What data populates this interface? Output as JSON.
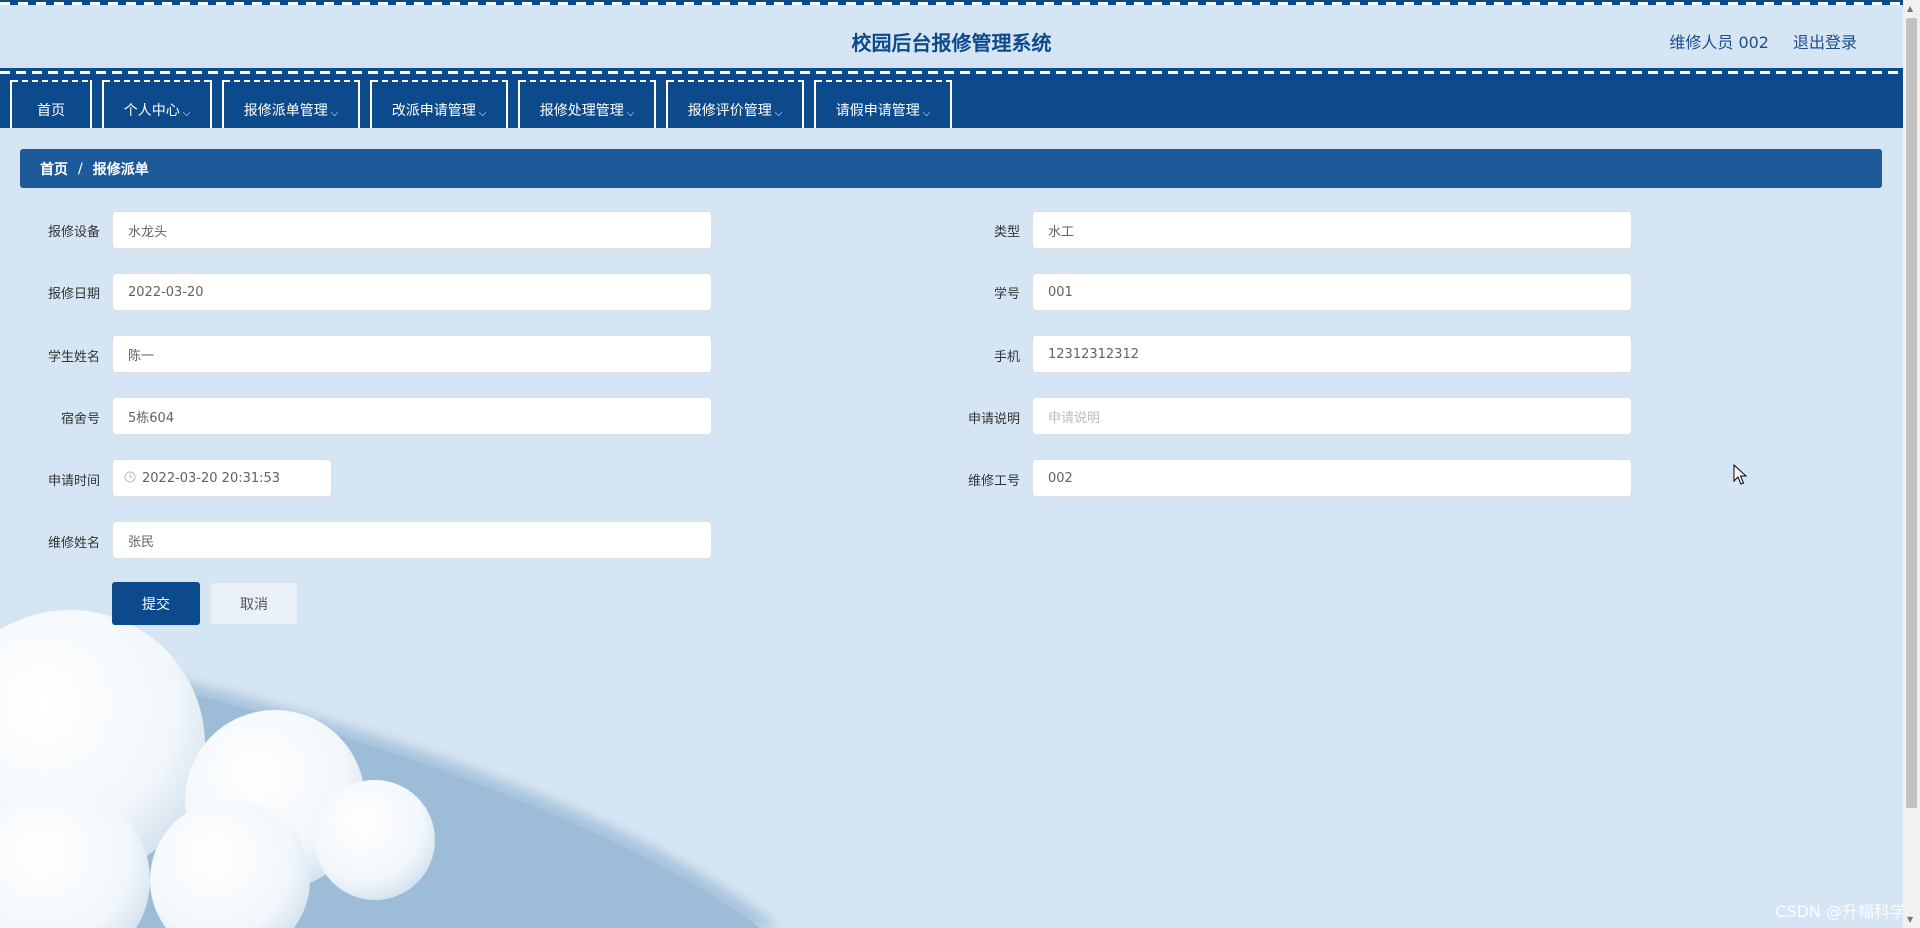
{
  "header": {
    "title": "校园后台报修管理系统",
    "user": "维修人员 002",
    "logout": "退出登录"
  },
  "nav": {
    "items": [
      {
        "label": "首页",
        "has_dropdown": false
      },
      {
        "label": "个人中心",
        "has_dropdown": true
      },
      {
        "label": "报修派单管理",
        "has_dropdown": true
      },
      {
        "label": "改派申请管理",
        "has_dropdown": true
      },
      {
        "label": "报修处理管理",
        "has_dropdown": true
      },
      {
        "label": "报修评价管理",
        "has_dropdown": true
      },
      {
        "label": "请假申请管理",
        "has_dropdown": true
      }
    ],
    "chevron": "⌵"
  },
  "breadcrumb": {
    "home": "首页",
    "separator": "/",
    "current": "报修派单"
  },
  "form": {
    "device_label": "报修设备",
    "device_value": "水龙头",
    "type_label": "类型",
    "type_value": "水工",
    "date_label": "报修日期",
    "date_value": "2022-03-20",
    "student_id_label": "学号",
    "student_id_value": "001",
    "student_name_label": "学生姓名",
    "student_name_value": "陈一",
    "phone_label": "手机",
    "phone_value": "12312312312",
    "dorm_label": "宿舍号",
    "dorm_value": "5栋604",
    "note_label": "申请说明",
    "note_placeholder": "申请说明",
    "apply_time_label": "申请时间",
    "apply_time_value": "2022-03-20 20:31:53",
    "worker_id_label": "维修工号",
    "worker_id_value": "002",
    "worker_name_label": "维修姓名",
    "worker_name_value": "张民"
  },
  "buttons": {
    "submit": "提交",
    "cancel": "取消"
  },
  "watermark": "CSDN @升幅科学",
  "icons": {
    "clock": "clock-icon",
    "chevron": "chevron-down-icon",
    "cursor": "mouse-cursor-icon"
  },
  "colors": {
    "primary": "#0d4a8c",
    "background": "#d6e5f3",
    "breadcrumb": "#1c5a9a"
  }
}
